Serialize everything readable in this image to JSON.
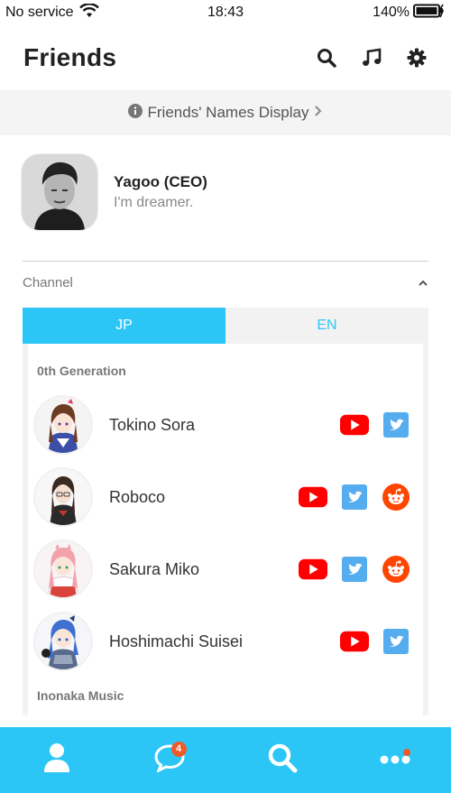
{
  "status_bar": {
    "carrier": "No service",
    "time": "18:43",
    "battery": "140%"
  },
  "header": {
    "title": "Friends"
  },
  "names_display": {
    "label": "Friends' Names Display"
  },
  "profile": {
    "name": "Yagoo (CEO)",
    "status": "I'm dreamer."
  },
  "channel": {
    "label": "Channel"
  },
  "tabs": [
    {
      "label": "JP",
      "active": true
    },
    {
      "label": "EN",
      "active": false
    }
  ],
  "groups": [
    {
      "label": "0th Generation"
    },
    {
      "label": "Inonaka Music"
    }
  ],
  "members": [
    {
      "name": "Tokino Sora",
      "socials": [
        "youtube-icon",
        "twitter-icon"
      ]
    },
    {
      "name": "Roboco",
      "socials": [
        "youtube-icon",
        "twitter-icon",
        "reddit-icon"
      ]
    },
    {
      "name": "Sakura Miko",
      "socials": [
        "youtube-icon",
        "twitter-icon",
        "reddit-icon"
      ]
    },
    {
      "name": "Hoshimachi Suisei",
      "socials": [
        "youtube-icon",
        "twitter-icon"
      ]
    }
  ],
  "bottom_nav": {
    "chat_badge": "4"
  },
  "colors": {
    "accent": "#2bc6f6",
    "youtube": "#ff0000",
    "twitter": "#55acee",
    "reddit": "#ff4500",
    "badge": "#f05a28"
  }
}
